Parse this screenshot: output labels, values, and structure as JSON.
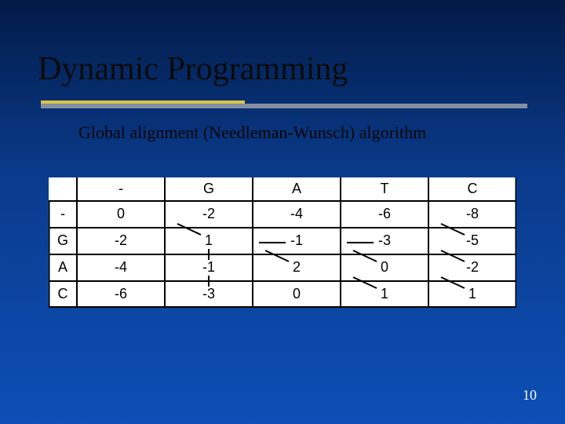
{
  "title": "Dynamic Programming",
  "subtitle": "Global alignment (Needleman-Wunsch) algorithm",
  "page_number": "10",
  "chart_data": {
    "type": "table",
    "title": "Needleman-Wunsch score matrix",
    "col_headers": [
      "-",
      "G",
      "A",
      "T",
      "C"
    ],
    "row_headers": [
      "-",
      "G",
      "A",
      "C"
    ],
    "cells": [
      [
        "0",
        "-2",
        "-4",
        "-6",
        "-8"
      ],
      [
        "-2",
        "1",
        "-1",
        "-3",
        "-5"
      ],
      [
        "-4",
        "-1",
        "2",
        "0",
        "-2"
      ],
      [
        "-6",
        "-3",
        "0",
        "1",
        "1"
      ]
    ],
    "traceback_arrows": [
      {
        "from_row": 1,
        "from_col": 1,
        "to_row": 0,
        "to_col": 0,
        "kind": "diag"
      },
      {
        "from_row": 1,
        "from_col": 2,
        "to_row": 1,
        "to_col": 1,
        "kind": "left"
      },
      {
        "from_row": 1,
        "from_col": 3,
        "to_row": 1,
        "to_col": 2,
        "kind": "left"
      },
      {
        "from_row": 1,
        "from_col": 4,
        "to_row": 0,
        "to_col": 3,
        "kind": "diag"
      },
      {
        "from_row": 2,
        "from_col": 1,
        "to_row": 1,
        "to_col": 1,
        "kind": "up"
      },
      {
        "from_row": 2,
        "from_col": 2,
        "to_row": 1,
        "to_col": 1,
        "kind": "diag"
      },
      {
        "from_row": 2,
        "from_col": 3,
        "to_row": 1,
        "to_col": 2,
        "kind": "diag"
      },
      {
        "from_row": 2,
        "from_col": 4,
        "to_row": 1,
        "to_col": 3,
        "kind": "diag"
      },
      {
        "from_row": 3,
        "from_col": 1,
        "to_row": 2,
        "to_col": 1,
        "kind": "up"
      },
      {
        "from_row": 3,
        "from_col": 3,
        "to_row": 2,
        "to_col": 2,
        "kind": "diag"
      },
      {
        "from_row": 3,
        "from_col": 4,
        "to_row": 2,
        "to_col": 3,
        "kind": "diag"
      }
    ]
  }
}
